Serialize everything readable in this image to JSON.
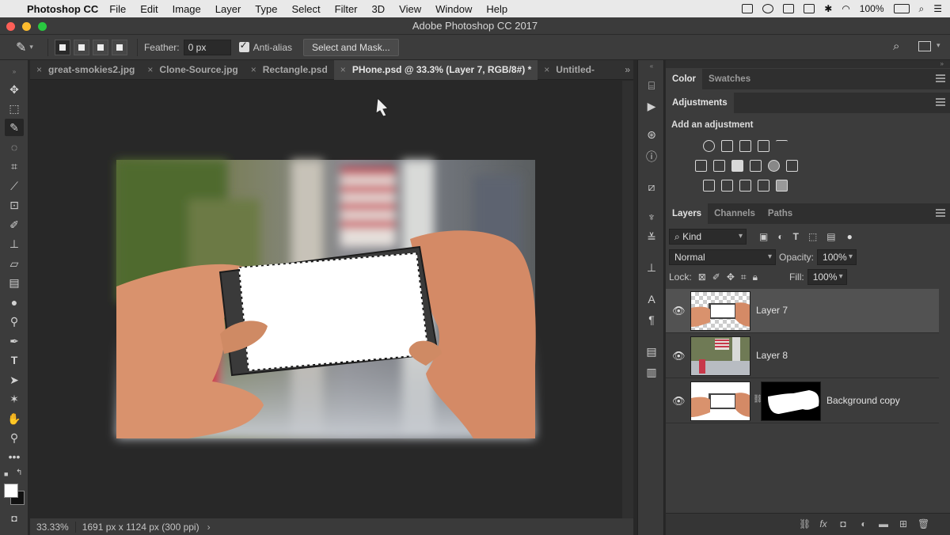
{
  "menubar": {
    "app_name": "Photoshop CC",
    "items": [
      "File",
      "Edit",
      "Image",
      "Layer",
      "Type",
      "Select",
      "Filter",
      "3D",
      "View",
      "Window",
      "Help"
    ],
    "battery": "100%"
  },
  "window": {
    "title": "Adobe Photoshop CC 2017"
  },
  "options": {
    "feather_label": "Feather:",
    "feather_value": "0 px",
    "antialias_label": "Anti-alias",
    "select_mask_label": "Select and Mask..."
  },
  "tabs": [
    {
      "label": "great-smokies2.jpg",
      "active": false
    },
    {
      "label": "Clone-Source.jpg",
      "active": false
    },
    {
      "label": "Rectangle.psd",
      "active": false
    },
    {
      "label": "PHone.psd @ 33.3% (Layer 7, RGB/8#) *",
      "active": true
    },
    {
      "label": "Untitled-",
      "active": false
    }
  ],
  "status": {
    "zoom": "33.33%",
    "doc_info": "1691 px x 1124 px (300 ppi)"
  },
  "panels": {
    "color_tabs": [
      "Color",
      "Swatches"
    ],
    "adjustments_tab": "Adjustments",
    "add_adjustment": "Add an adjustment",
    "layer_tabs": [
      "Layers",
      "Channels",
      "Paths"
    ],
    "filter_kind": "Kind",
    "blend_mode": "Normal",
    "opacity_label": "Opacity:",
    "opacity_value": "100%",
    "lock_label": "Lock:",
    "fill_label": "Fill:",
    "fill_value": "100%",
    "layers": [
      {
        "name": "Layer 7",
        "selected": true
      },
      {
        "name": "Layer 8",
        "selected": false
      },
      {
        "name": "Background copy",
        "selected": false
      }
    ],
    "footer_fx": "fx"
  },
  "colors": {
    "ui_dark": "#282828",
    "panel": "#3c3c3c",
    "selected_layer": "#525252",
    "flag_red": "#c8384a",
    "skin": "#d9926d"
  }
}
